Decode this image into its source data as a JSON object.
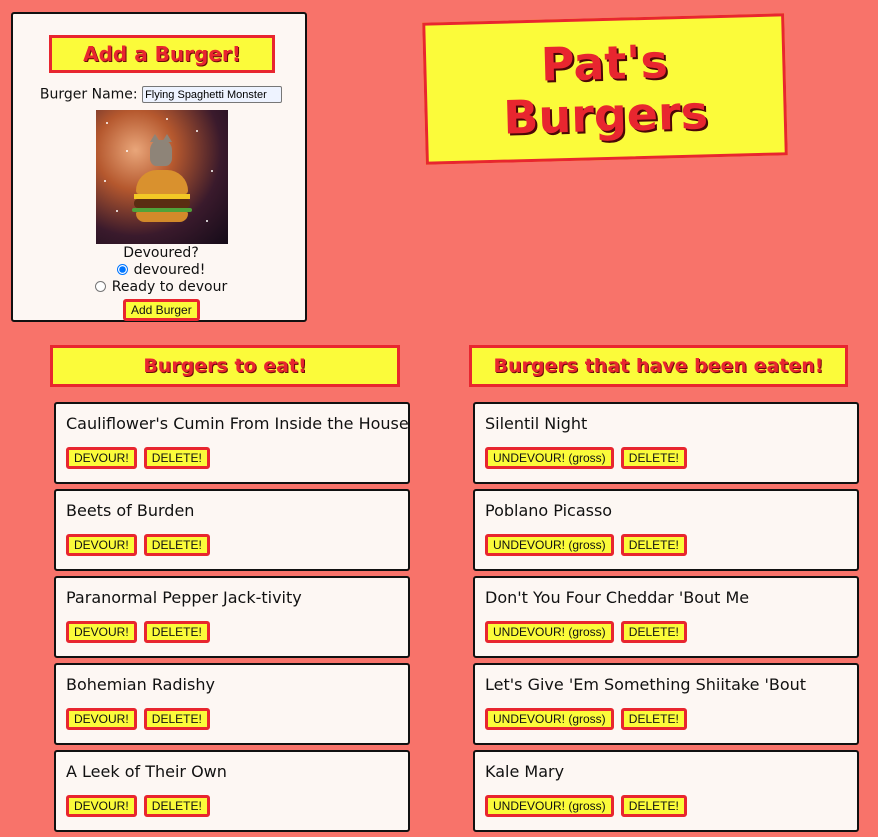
{
  "header": {
    "title_line1": "Pat's",
    "title_line2": "Burgers"
  },
  "form": {
    "title": "Add a Burger!",
    "name_label": "Burger Name:",
    "name_value": "Flying Spaghetti Monster",
    "devoured_label": "Devoured?",
    "radio_devoured": "devoured!",
    "radio_ready": "Ready to devour",
    "selected": "devoured!",
    "submit_label": "Add Burger"
  },
  "to_eat": {
    "title": "Burgers to eat!",
    "devour_label": "DEVOUR!",
    "delete_label": "DELETE!",
    "items": [
      {
        "name": "Cauliflower's Cumin From Inside the House"
      },
      {
        "name": "Beets of Burden"
      },
      {
        "name": "Paranormal Pepper Jack-tivity"
      },
      {
        "name": "Bohemian Radishy"
      },
      {
        "name": "A Leek of Their Own"
      }
    ]
  },
  "eaten": {
    "title": "Burgers that have been eaten!",
    "undevour_label": "UNDEVOUR! (gross)",
    "delete_label": "DELETE!",
    "items": [
      {
        "name": "Silentil Night"
      },
      {
        "name": "Poblano Picasso"
      },
      {
        "name": "Don't You Four Cheddar 'Bout Me"
      },
      {
        "name": "Let's Give 'Em Something Shiitake 'Bout"
      },
      {
        "name": "Kale Mary"
      }
    ]
  },
  "colors": {
    "background": "#f8736a",
    "accent_yellow": "#fbfb3a",
    "accent_red": "#e8262f"
  }
}
